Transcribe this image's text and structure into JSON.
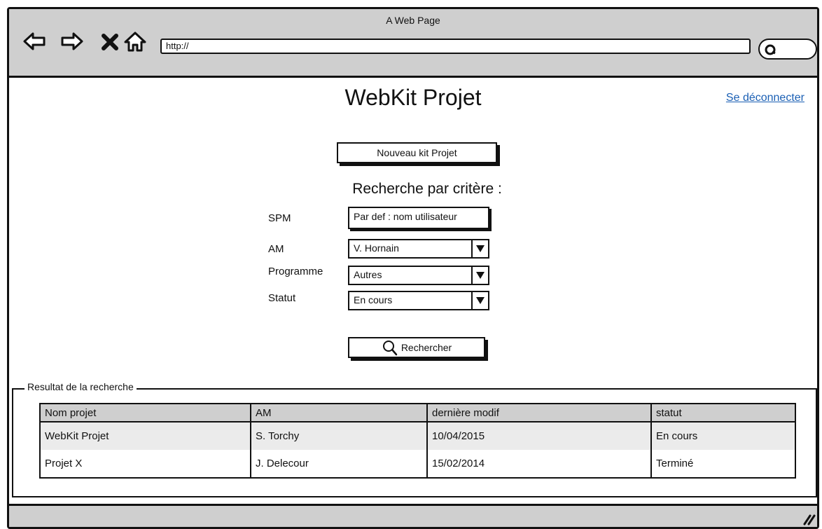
{
  "window": {
    "title": "A Web Page"
  },
  "browser": {
    "url": "http://",
    "icons": [
      "back-arrow-icon",
      "forward-arrow-icon",
      "close-icon",
      "home-icon",
      "search-icon"
    ]
  },
  "header": {
    "title": "WebKit Projet",
    "logout_label": "Se déconnecter"
  },
  "actions": {
    "new_kit_label": "Nouveau kit Projet"
  },
  "search": {
    "heading": "Recherche par critère :",
    "spm": {
      "label": "SPM",
      "value": "Par def : nom utilisateur"
    },
    "am": {
      "label": "AM",
      "value": "V. Hornain"
    },
    "programme": {
      "label": "Programme",
      "value": "Autres"
    },
    "statut": {
      "label": "Statut",
      "value": "En cours"
    },
    "button_label": "Rechercher"
  },
  "results": {
    "legend": "Resultat de la recherche",
    "columns": [
      "Nom projet",
      "AM",
      "dernière modif",
      "statut"
    ],
    "rows": [
      [
        "WebKit Projet",
        "S. Torchy",
        "10/04/2015",
        "En cours"
      ],
      [
        "Projet X",
        "J. Delecour",
        "15/02/2014",
        "Terminé"
      ]
    ]
  }
}
